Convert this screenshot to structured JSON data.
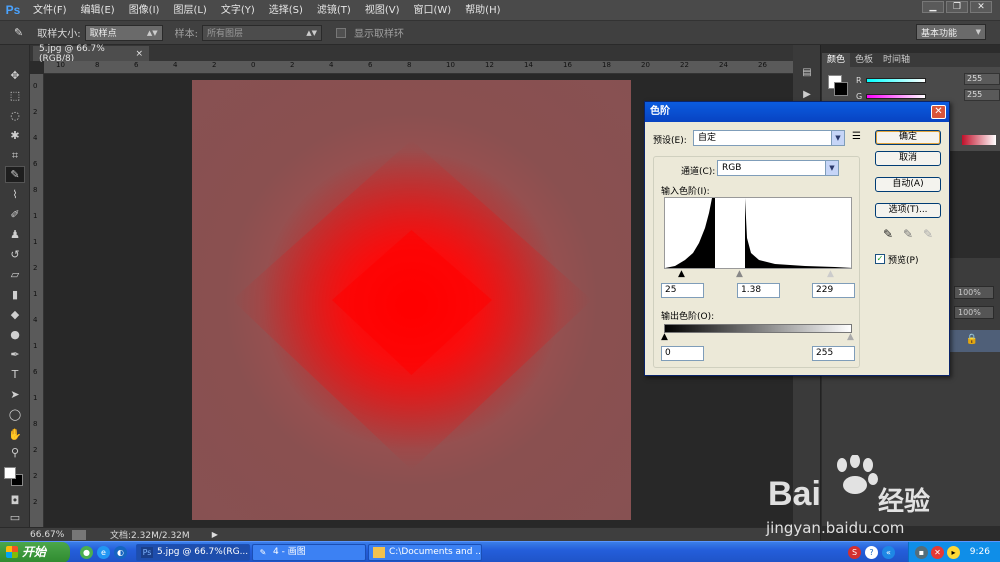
{
  "menubar": {
    "logo": "Ps",
    "items": [
      "文件(F)",
      "编辑(E)",
      "图像(I)",
      "图层(L)",
      "文字(Y)",
      "选择(S)",
      "滤镜(T)",
      "视图(V)",
      "窗口(W)",
      "帮助(H)"
    ]
  },
  "options": {
    "sample_size_label": "取样大小:",
    "sample_size_value": "取样点",
    "sample_label": "样本:",
    "sample_value": "所有图层",
    "show_ring_label": "显示取样环",
    "workspace": "基本功能"
  },
  "document": {
    "tab_title": "5.jpg @ 66.7%(RGB/8)",
    "tab_close": "×"
  },
  "ruler": {
    "top": [
      "10",
      "8",
      "6",
      "4",
      "2",
      "0",
      "2",
      "4",
      "6",
      "8",
      "10",
      "12",
      "14",
      "16",
      "18",
      "20",
      "22",
      "24",
      "26",
      "28"
    ],
    "left": [
      "0",
      "2",
      "4",
      "6",
      "8",
      "1",
      "1",
      "2",
      "1",
      "4",
      "1",
      "6",
      "1",
      "8",
      "2",
      "2",
      "2"
    ]
  },
  "statusbar": {
    "zoom": "66.67%",
    "doc_info": "文档:2.32M/2.32M"
  },
  "color_panel": {
    "tabs": [
      "颜色",
      "色板",
      "时间轴"
    ],
    "r_label": "R",
    "r_value": "255",
    "g_label": "G",
    "g_value": "255"
  },
  "layers_panel": {
    "opacity": "100%",
    "fill": "100%"
  },
  "levels": {
    "title": "色阶",
    "preset_label": "预设(E):",
    "preset_value": "自定",
    "channel_label": "通道(C):",
    "channel_value": "RGB",
    "input_label": "输入色阶(I):",
    "input_black": "25",
    "input_gamma": "1.38",
    "input_white": "229",
    "output_label": "输出色阶(O):",
    "output_black": "0",
    "output_white": "255",
    "buttons": {
      "ok": "确定",
      "cancel": "取消",
      "auto": "自动(A)",
      "options": "选项(T)..."
    },
    "preview_label": "预览(P)",
    "preview_checked": true
  },
  "taskbar": {
    "start": "开始",
    "tasks": [
      "5.jpg @ 66.7%(RG...",
      "4 - 画图",
      "C:\\Documents and ..."
    ],
    "clock": "9:26"
  },
  "watermark": {
    "brand": "Bai",
    "brand_cn": "经验",
    "url": "jingyan.baidu.com"
  }
}
